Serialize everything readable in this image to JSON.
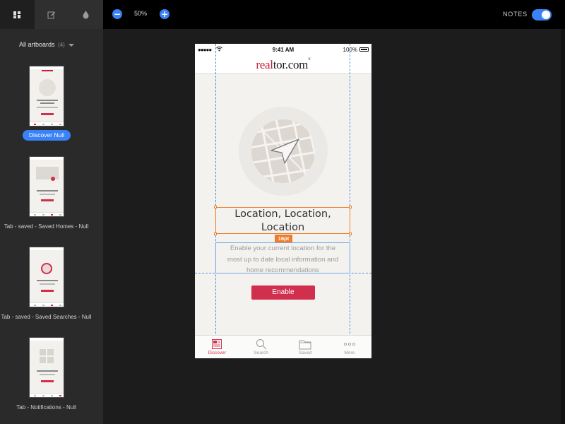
{
  "left_toolbar": {
    "tabs": [
      {
        "icon": "artboards-grid-icon",
        "active": true
      },
      {
        "icon": "edit-note-icon",
        "active": false
      },
      {
        "icon": "color-drop-icon",
        "active": false
      }
    ]
  },
  "top_toolbar": {
    "zoom_out_symbol": "−",
    "zoom_level": "50%",
    "zoom_in_symbol": "+",
    "notes_label": "NOTES",
    "notes_enabled": true
  },
  "sidebar": {
    "title": "All artboards",
    "count": "(4)",
    "artboards": [
      {
        "label": "Discover Null",
        "selected": true
      },
      {
        "label": "Tab - saved - Saved Homes - Null",
        "selected": false
      },
      {
        "label": "Tab - saved - Saved Searches - Null",
        "selected": false
      },
      {
        "label": "Tab - Notifications - Null",
        "selected": false
      }
    ]
  },
  "artboard": {
    "status_bar": {
      "signal": "●●●●●",
      "time": "9:41 AM",
      "battery": "100%"
    },
    "logo": {
      "part1": "real",
      "part2": "tor.com",
      "mark": "®"
    },
    "heading_lines": [
      "Location, Location,",
      "Location"
    ],
    "spacing_badge": "16pt",
    "body_lines": [
      "Enable your current location for the",
      "most up to date local information and",
      "home recommendations"
    ],
    "button_label": "Enable",
    "tabs": [
      {
        "label": "Discover",
        "icon": "discover-icon",
        "active": true
      },
      {
        "label": "Search",
        "icon": "search-icon",
        "active": false
      },
      {
        "label": "Saved",
        "icon": "folder-icon",
        "active": false
      },
      {
        "label": "More",
        "icon": "more-icon",
        "active": false
      }
    ]
  },
  "colors": {
    "accent_blue": "#3a82f7",
    "brand_red": "#d0304e",
    "selection_orange": "#f07c2a",
    "guide_blue": "#4a90e2"
  }
}
